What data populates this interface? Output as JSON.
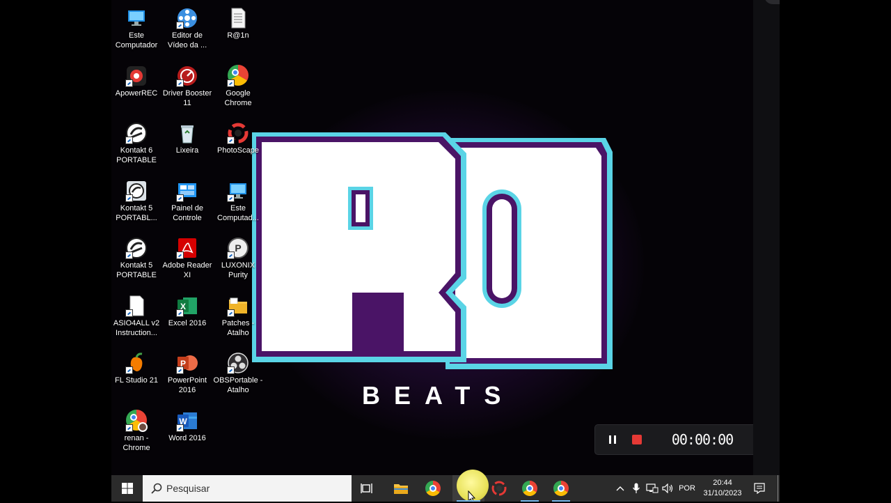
{
  "desktop": {
    "icons": [
      {
        "name": "este-computador",
        "label": "Este\nComputador",
        "icon": "monitor-icon"
      },
      {
        "name": "editor-video",
        "label": "Editor de\nVídeo da ...",
        "icon": "film-reel-icon"
      },
      {
        "name": "r1n",
        "label": "R@1n",
        "icon": "text-file-icon"
      },
      {
        "name": "apowerrec",
        "label": "ApowerREC",
        "icon": "record-camera-icon"
      },
      {
        "name": "driver-booster",
        "label": "Driver Booster\n11",
        "icon": "driver-booster-icon"
      },
      {
        "name": "google-chrome",
        "label": "Google\nChrome",
        "icon": "chrome-icon"
      },
      {
        "name": "kontakt6",
        "label": "Kontakt 6\nPORTABLE",
        "icon": "kontakt-icon"
      },
      {
        "name": "lixeira",
        "label": "Lixeira",
        "icon": "recycle-bin-icon"
      },
      {
        "name": "photoscape",
        "label": "PhotoScape",
        "icon": "photoscape-icon"
      },
      {
        "name": "kontakt5-portabl",
        "label": "Kontakt 5\nPORTABL...",
        "icon": "kontakt5-folder-icon"
      },
      {
        "name": "painel-controle",
        "label": "Painel de\nControle",
        "icon": "control-panel-icon"
      },
      {
        "name": "este-computad",
        "label": "Este\nComputad...",
        "icon": "monitor-icon"
      },
      {
        "name": "kontakt5-portable",
        "label": "Kontakt 5\nPORTABLE",
        "icon": "kontakt-icon"
      },
      {
        "name": "adobe-reader",
        "label": "Adobe Reader\nXI",
        "icon": "pdf-icon"
      },
      {
        "name": "luxonix",
        "label": "LUXONIX\nPurity",
        "icon": "luxonix-icon"
      },
      {
        "name": "asio4all",
        "label": "ASIO4ALL v2\nInstruction...",
        "icon": "document-icon"
      },
      {
        "name": "excel2016",
        "label": "Excel 2016",
        "icon": "excel-icon"
      },
      {
        "name": "patches",
        "label": "Patches -\nAtalho",
        "icon": "folder-icon"
      },
      {
        "name": "fl-studio",
        "label": "FL Studio 21",
        "icon": "fl-studio-icon"
      },
      {
        "name": "powerpoint2016",
        "label": "PowerPoint\n2016",
        "icon": "powerpoint-icon"
      },
      {
        "name": "obsportable",
        "label": "OBSPortable -\nAtalho",
        "icon": "obs-icon"
      },
      {
        "name": "renan-chrome",
        "label": "renan -\nChrome",
        "icon": "chrome-profile-icon"
      },
      {
        "name": "word2016",
        "label": "Word 2016",
        "icon": "word-icon"
      }
    ]
  },
  "wallpaper": {
    "logo_text": "R",
    "logo_text2": "O",
    "subtitle": "BEATS"
  },
  "recorder": {
    "timer": "00:00:00"
  },
  "taskbar": {
    "search_placeholder": "Pesquisar",
    "language": "POR",
    "time": "20:44",
    "date": "31/10/2023"
  },
  "colors": {
    "accent_cyan": "#5ad4e6",
    "logo_purple": "#4a1466",
    "glow": "#7a2aa8",
    "record_red": "#e53935",
    "taskbar": "#2b2b2b"
  }
}
